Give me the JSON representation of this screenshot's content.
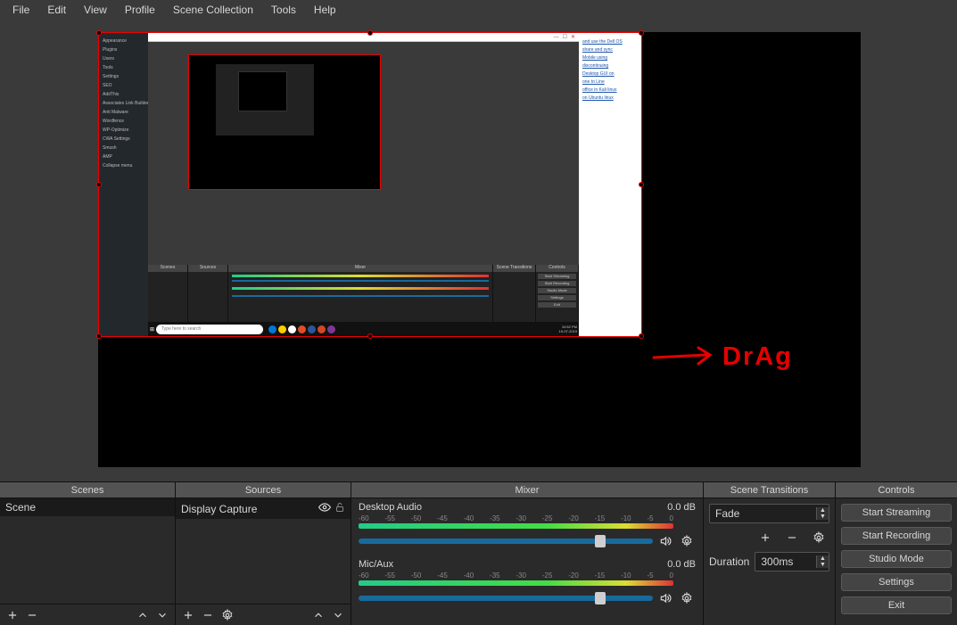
{
  "menu": {
    "file": "File",
    "edit": "Edit",
    "view": "View",
    "profile": "Profile",
    "scene_col": "Scene Collection",
    "tools": "Tools",
    "help": "Help"
  },
  "annotation": "DrAg",
  "panels": {
    "scenes": {
      "title": "Scenes",
      "item": "Scene"
    },
    "sources": {
      "title": "Sources",
      "item": "Display Capture"
    },
    "mixer": {
      "title": "Mixer",
      "ch1": {
        "name": "Desktop Audio",
        "db": "0.0 dB"
      },
      "ch2": {
        "name": "Mic/Aux",
        "db": "0.0 dB"
      },
      "ticks": [
        "-60",
        "-55",
        "-50",
        "-45",
        "-40",
        "-35",
        "-30",
        "-25",
        "-20",
        "-15",
        "-10",
        "-5",
        "0"
      ]
    },
    "transitions": {
      "title": "Scene Transitions",
      "select": "Fade",
      "dur_label": "Duration",
      "dur_value": "300ms"
    },
    "controls": {
      "title": "Controls",
      "start_stream": "Start Streaming",
      "start_rec": "Start Recording",
      "studio": "Studio Mode",
      "settings": "Settings",
      "exit": "Exit"
    }
  },
  "mini": {
    "search_placeholder": "Type here to search",
    "side": [
      "Appearance",
      "Plugins",
      "Users",
      "Tools",
      "Settings",
      "SEO",
      "AddThis",
      "Associates Link Builder",
      "Anti Malware",
      "Wordfence",
      "WP-Optimize",
      "CWA Settings",
      "Smush",
      "AMP",
      "Collapse menu"
    ],
    "links": [
      "and use the Dell OS",
      "share and sync",
      "Mobile using",
      "discontinuing",
      "Desktop GUI on",
      "one to Line",
      "office in Kali linux",
      "on Ubuntu linux"
    ],
    "time": "10:52 PM",
    "date": "19-07-2019"
  }
}
